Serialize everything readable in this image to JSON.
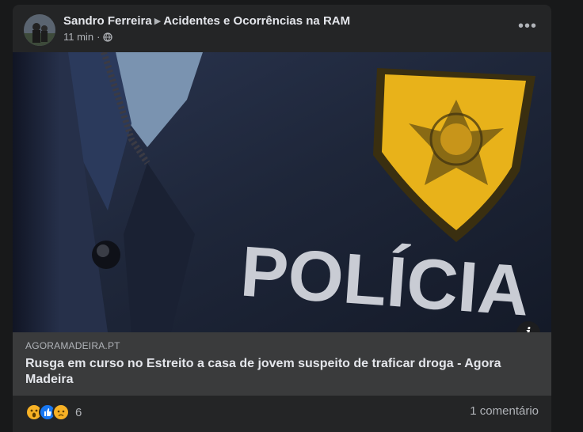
{
  "post": {
    "author": "Sandro Ferreira",
    "group": "Acidentes e Ocorrências na RAM",
    "time": "11 min",
    "separator": "·",
    "more_label": "•••"
  },
  "photo": {
    "patch_text": "POLÍCIA"
  },
  "link": {
    "domain": "AGORAMADEIRA.PT",
    "title": "Rusga em curso no Estreito a casa de jovem suspeito de traficar droga - Agora Madeira"
  },
  "footer": {
    "reaction_count": "6",
    "comments_label": "1 comentário",
    "reactions": [
      "wow-icon",
      "like-icon",
      "sad-icon"
    ]
  },
  "colors": {
    "background": "#18191a",
    "card": "#242526",
    "preview": "#3a3b3c",
    "badge_gold": "#e8b21a"
  }
}
